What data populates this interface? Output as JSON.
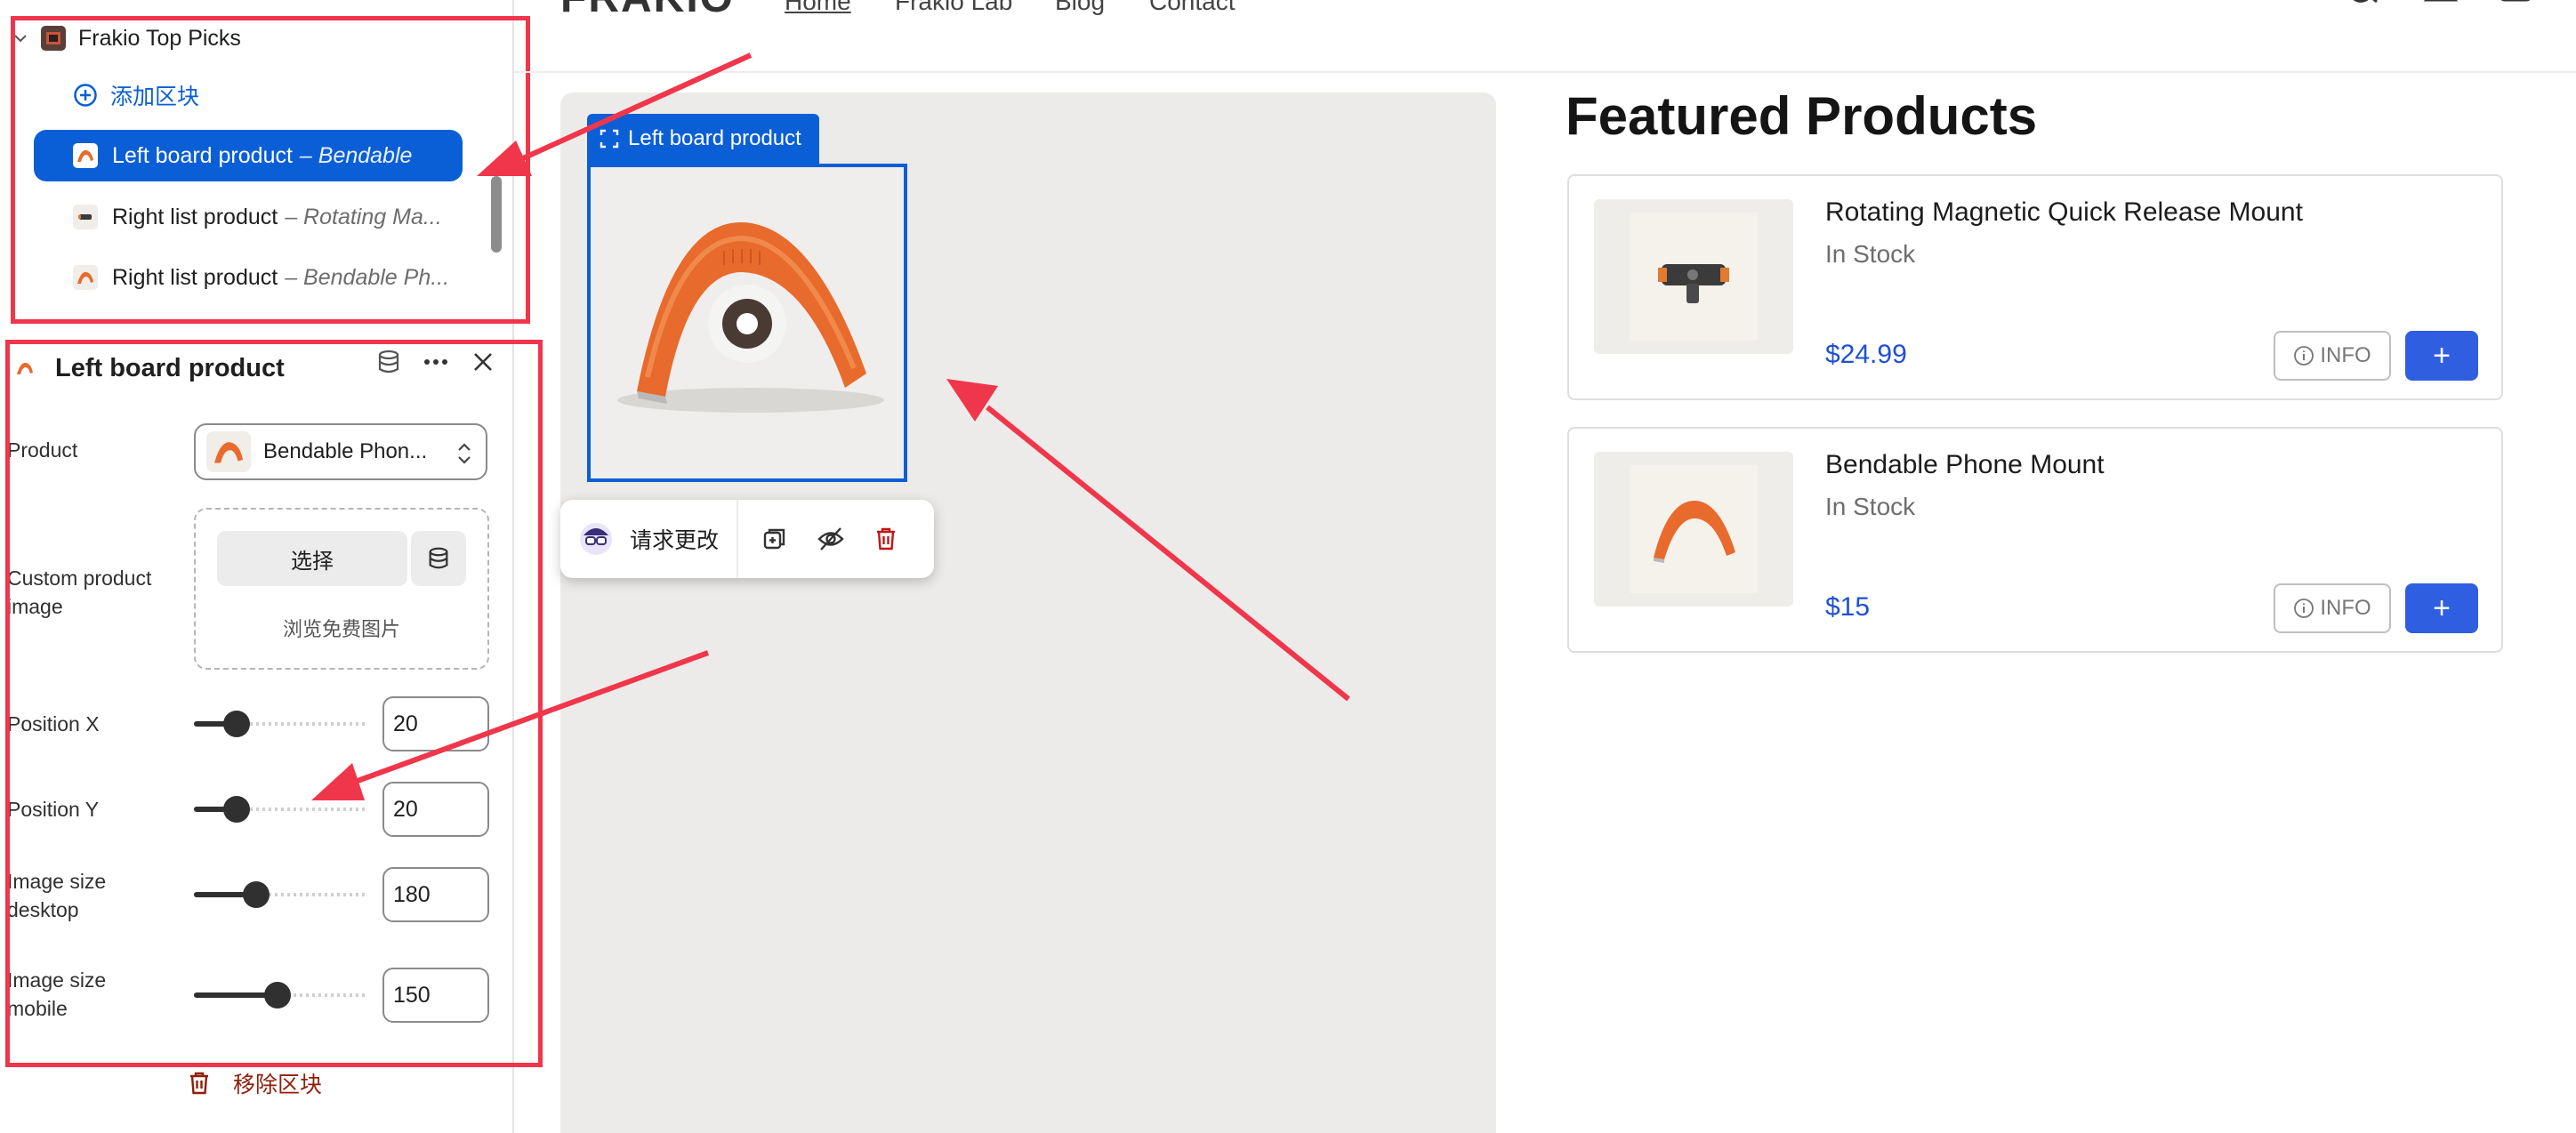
{
  "sidebar": {
    "section": {
      "title": "Frakio Top Picks",
      "add_block": "添加区块"
    },
    "blocks": [
      {
        "title": "Left board product",
        "subtitle": "– Bendable",
        "selected": true
      },
      {
        "title": "Right list product",
        "subtitle": "– Rotating Ma..."
      },
      {
        "title": "Right list product",
        "subtitle": "– Bendable Ph..."
      }
    ]
  },
  "panel": {
    "title": "Left board product",
    "product_label": "Product",
    "product_value": "Bendable Phon...",
    "custom_image_label_1": "Custom product",
    "custom_image_label_2": "image",
    "choose_button": "选择",
    "browse_free": "浏览免费图片",
    "position_x_label": "Position X",
    "position_x": "20",
    "position_y_label": "Position Y",
    "position_y": "20",
    "size_desktop_label_1": "Image size",
    "size_desktop_label_2": "desktop",
    "size_desktop": "180",
    "size_mobile_label_1": "Image size",
    "size_mobile_label_2": "mobile",
    "size_mobile": "150",
    "remove_block": "移除区块"
  },
  "storefront": {
    "logo": "FRAKIO",
    "nav": [
      "Home",
      "Frakio Lab",
      "Blog",
      "Contact"
    ],
    "block_tag": "Left board product",
    "request_change": "请求更改",
    "featured_title": "Featured Products",
    "products": [
      {
        "name": "Rotating Magnetic Quick Release Mount",
        "stock": "In Stock",
        "price": "$24.99",
        "info": "INFO",
        "add": "+"
      },
      {
        "name": "Bendable Phone Mount",
        "stock": "In Stock",
        "price": "$15",
        "info": "INFO",
        "add": "+"
      }
    ]
  },
  "colors": {
    "accent": "#0a5fd6",
    "annotation": "#f0364b",
    "price": "#1f4fd6",
    "add_button": "#2f5fe0",
    "danger": "#8e1f0b"
  }
}
